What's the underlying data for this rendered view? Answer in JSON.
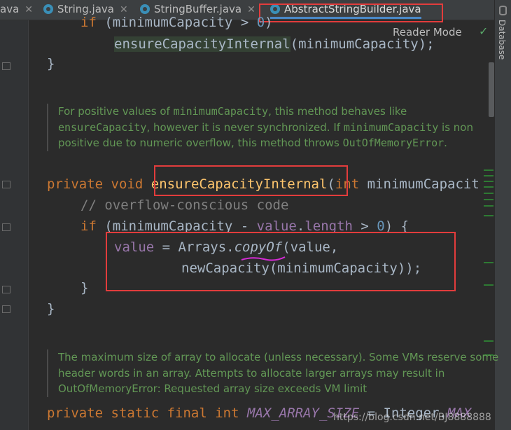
{
  "tabs": [
    {
      "label": "ava",
      "partial": true
    },
    {
      "label": "String.java"
    },
    {
      "label": "StringBuffer.java"
    },
    {
      "label": "AbstractStringBuilder.java",
      "active": true
    }
  ],
  "toolbar": {
    "reader_mode": "Reader Mode",
    "check_icon": "check-icon"
  },
  "side_panel": {
    "database_label": "Database"
  },
  "code": {
    "line1": {
      "kw": "if",
      "open": " (",
      "var": "minimumCapacity",
      "rest": " > ",
      "num": "0",
      "close": ")"
    },
    "line2": {
      "call": "ensureCapacityInternal",
      "args": "(minimumCapacity);"
    },
    "line3": "}",
    "doc1": {
      "t1": "For positive values of ",
      "c1": "minimumCapacity",
      "t2": ", this method behaves like ",
      "c2": "ensureCapacity",
      "t3": ", however it is never synchronized. If ",
      "c3": "minimumCapacity",
      "t4": " is non positive due to numeric overflow, this method throws ",
      "c4": "OutOfMemoryError",
      "t5": "."
    },
    "sig": {
      "mod": "private",
      "type": "void",
      "name": "ensureCapacityInternal",
      "open": "(",
      "ptype": "int",
      "param": " minimumCapacit"
    },
    "comment": "// overflow-conscious code",
    "if2": {
      "kw": "if",
      "open": " (minimumCapacity - ",
      "field1": "value",
      "dot": ".",
      "field2": "length",
      "rest": " > ",
      "num": "0",
      "close": ") {"
    },
    "assign": {
      "field": "value",
      "eq": " = Arrays.",
      "method": "copyOf",
      "open": "(value,"
    },
    "assign2": "newCapacity(minimumCapacity));",
    "close_if": "}",
    "close_method": "}",
    "doc2": "The maximum size of array to allocate (unless necessary). Some VMs reserve some header words in an array. Attempts to allocate larger arrays may result in OutOfMemoryError: Requested array size exceeds VM limit",
    "last": {
      "mods": "private static final",
      "type": "int",
      "const": "MAX_ARRAY_SIZE",
      "rest": " = Integer.",
      "tail": "MAX"
    }
  },
  "watermark": "https://blog.csdn.net/BJ8888888",
  "colors": {
    "highlight": "#e23c3c",
    "keyword": "#cc7832",
    "method": "#ffc66d",
    "field": "#9876aa",
    "doc": "#629755"
  }
}
